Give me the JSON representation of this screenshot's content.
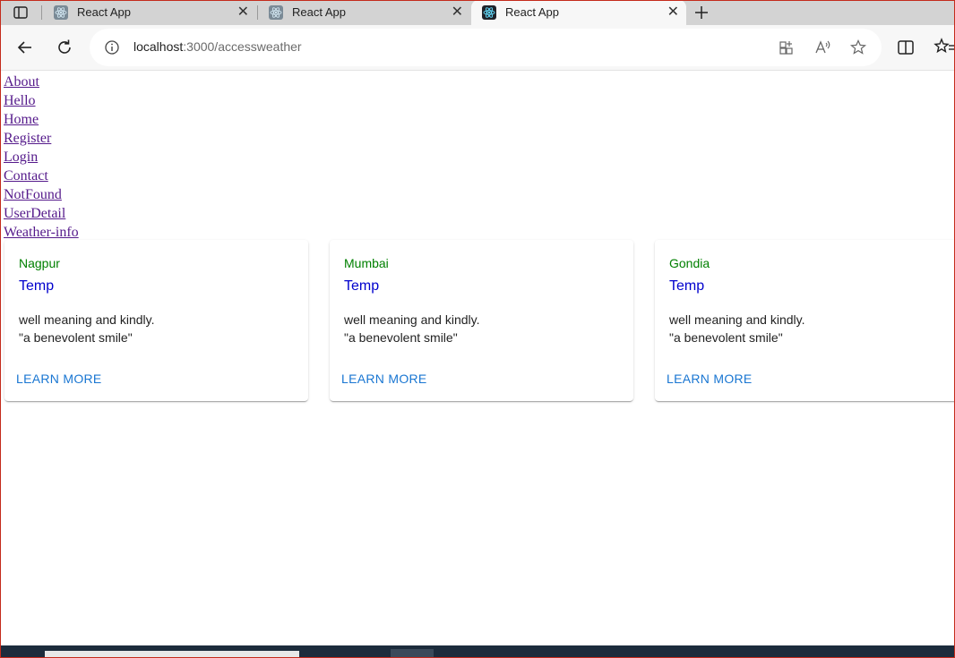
{
  "browser": {
    "tabs": [
      {
        "title": "React App",
        "active": false
      },
      {
        "title": "React App",
        "active": false
      },
      {
        "title": "React App",
        "active": true
      }
    ],
    "new_tab_icon": "plus-icon",
    "url_host": "localhost",
    "url_path": ":3000/accessweather",
    "toolbar_icons": [
      "back-icon",
      "reload-icon",
      "info-icon",
      "apps-icon",
      "read-aloud-icon",
      "favorite-star-icon",
      "split-screen-icon",
      "favorites-icon"
    ]
  },
  "nav": {
    "links": [
      "About",
      "Hello",
      "Home",
      "Register",
      "Login",
      "Contact",
      "NotFound",
      "UserDetail",
      "Weather-info"
    ]
  },
  "cards": [
    {
      "city": "Nagpur",
      "temp": "Temp",
      "line1": "well meaning and kindly.",
      "line2": "\"a benevolent smile\"",
      "action": "LEARN MORE"
    },
    {
      "city": "Mumbai",
      "temp": "Temp",
      "line1": "well meaning and kindly.",
      "line2": "\"a benevolent smile\"",
      "action": "LEARN MORE"
    },
    {
      "city": "Gondia",
      "temp": "Temp",
      "line1": "well meaning and kindly.",
      "line2": "\"a benevolent smile\"",
      "action": "LEARN MORE"
    }
  ],
  "colors": {
    "city": "#008000",
    "temp": "#0000cd",
    "action": "#1976d2",
    "link_visited": "#551a8b"
  }
}
